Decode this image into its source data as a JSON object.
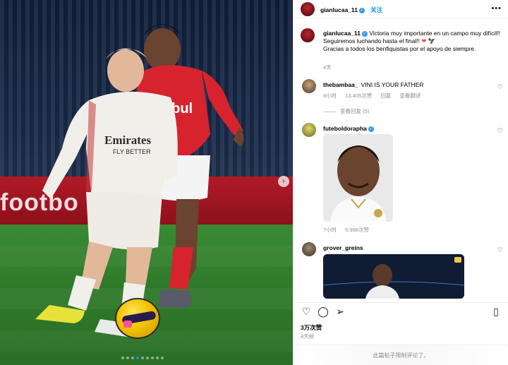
{
  "post": {
    "author": "gianlucaa_11",
    "follow_label": "关注",
    "caption_author": "gianlucaa_11",
    "caption_line1": "Victoria muy importante en un campo muy difícil!!",
    "caption_line2": "Seguiremos luchando hasta el final!!",
    "caption_line3": "Gracias a todos los benfiquistas por el apoyo de siempre.",
    "caption_time": "4天",
    "likes": "3万次赞",
    "time": "4天前",
    "comments_closed": "此篇帖子限制评论了。"
  },
  "photo": {
    "adboard_text": "footbo",
    "jersey_sponsor_red": "ebul",
    "jersey_sponsor_white_1": "Emirates",
    "jersey_sponsor_white_2": "FLY BETTER",
    "carousel_dots": 9,
    "active_dot": 4
  },
  "comments": [
    {
      "user": "thebambaa_",
      "text": "VINI IS YOUR FATHER",
      "time": "8小时",
      "likes": "13,405次赞",
      "reply": "回复",
      "translate": "查看翻译",
      "view_replies": "查看回复 (5)"
    },
    {
      "user": "futeboldorapha",
      "time": "7小时",
      "likes": "5,968次赞"
    },
    {
      "user": "grover_greins"
    }
  ],
  "colors": {
    "accent": "#0095f6",
    "verified": "#3797f0",
    "muted": "#8e8e8e",
    "benfica_red": "#d6232e"
  }
}
